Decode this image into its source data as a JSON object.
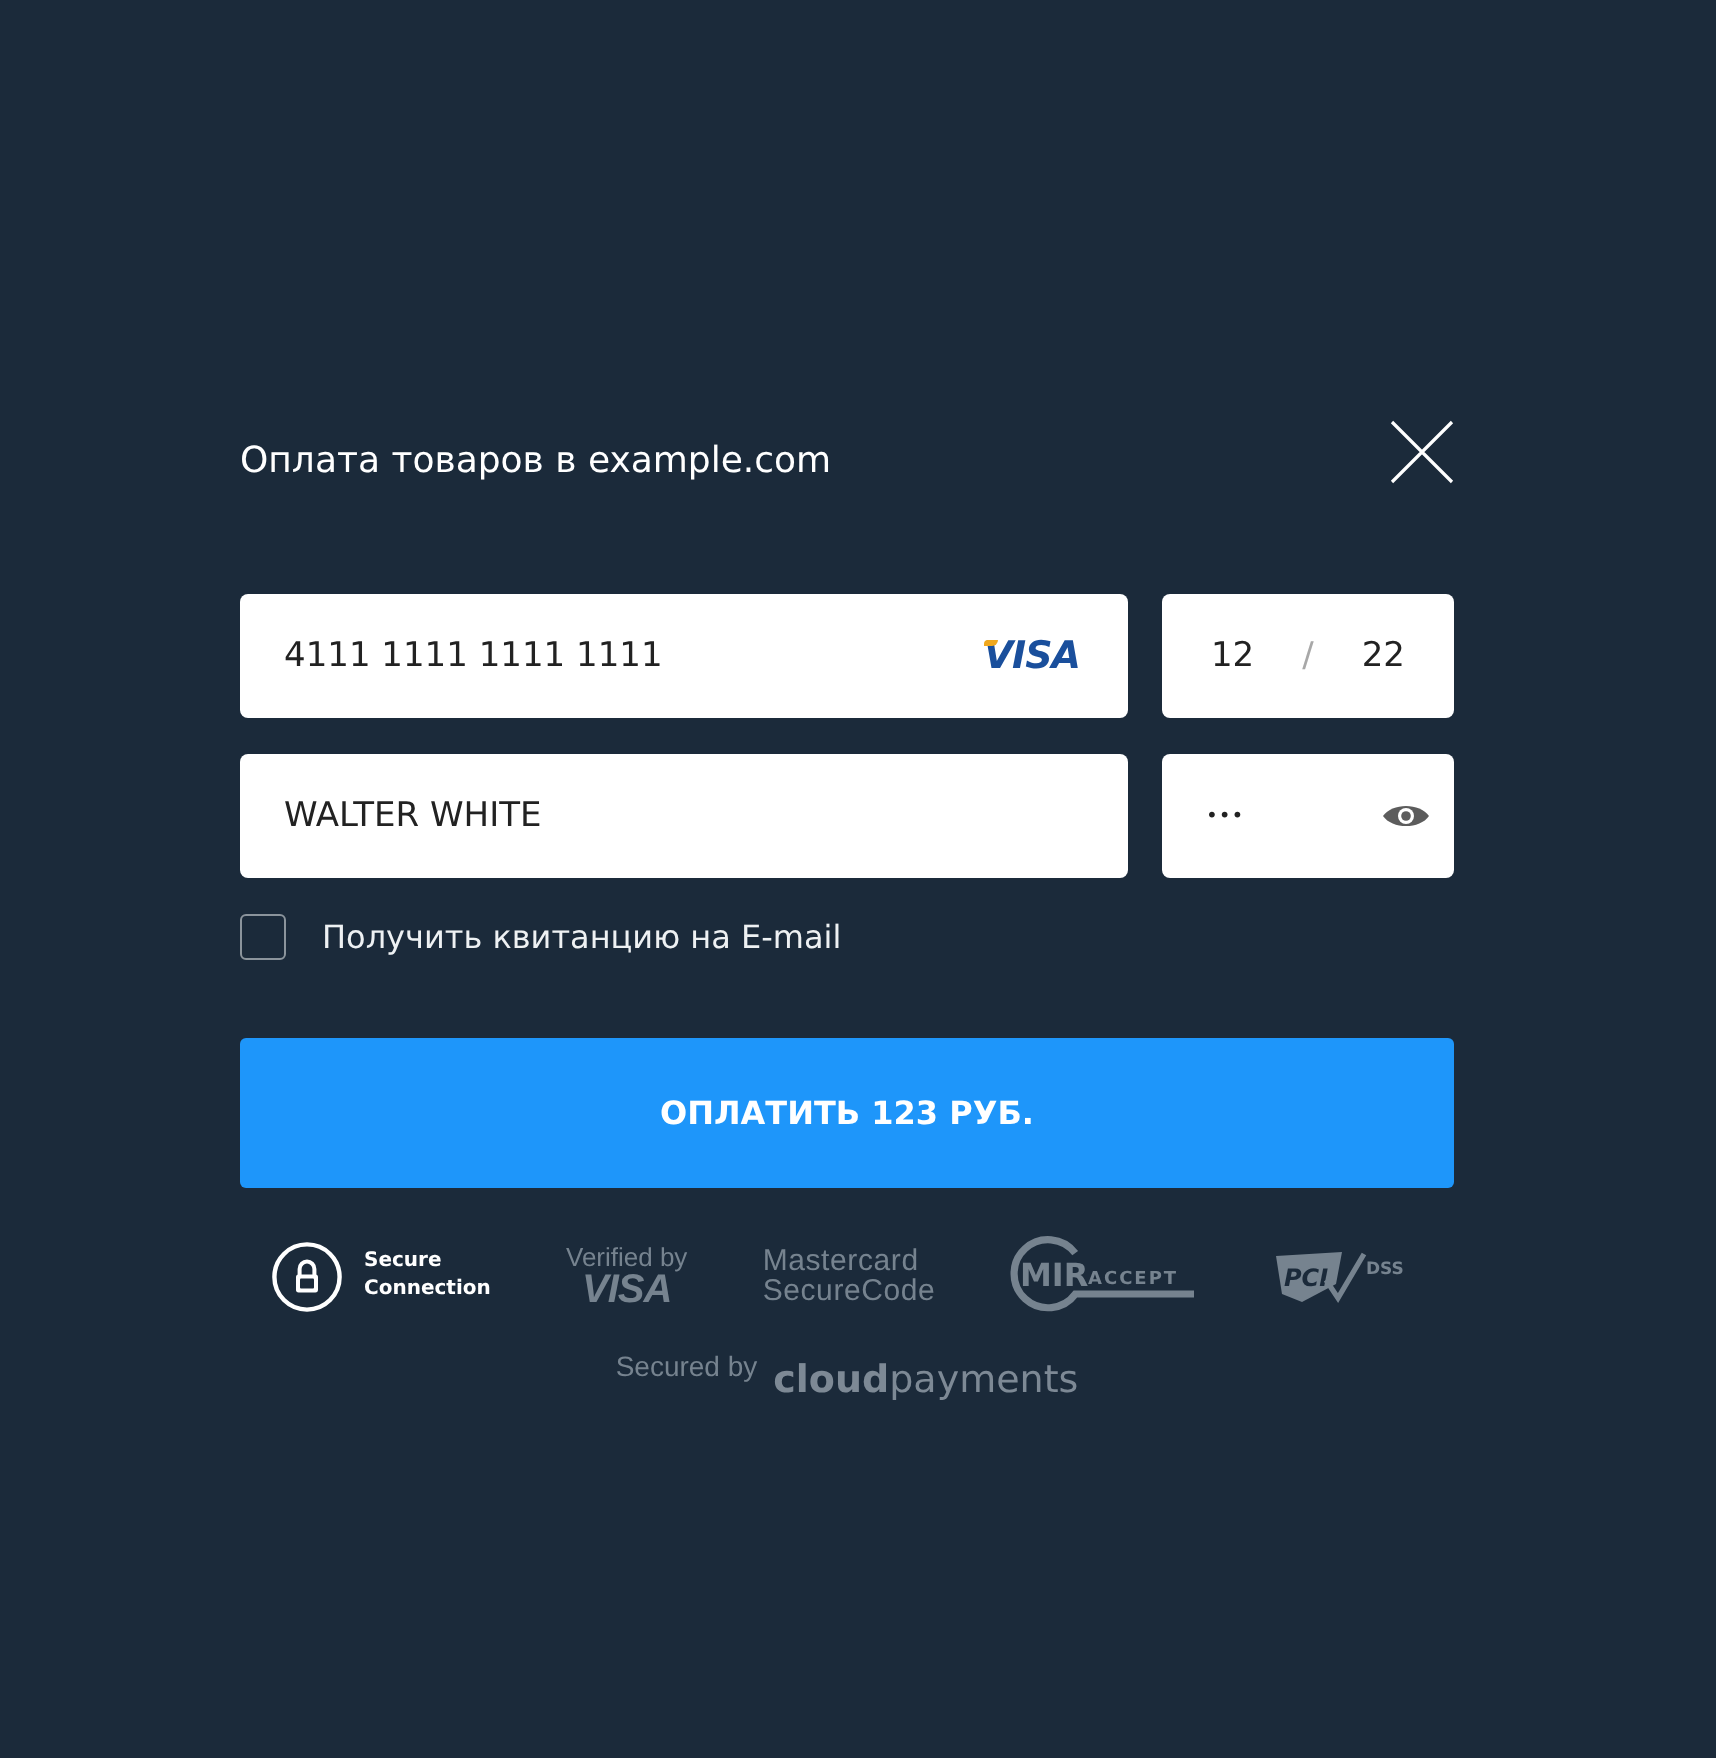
{
  "dialog": {
    "title": "Оплата товаров в example.com"
  },
  "card_number": {
    "value": "4111 1111 1111 1111",
    "brand": "VISA"
  },
  "expiry": {
    "month": "12",
    "separator": "/",
    "year": "22"
  },
  "cardholder": {
    "value": "WALTER WHITE"
  },
  "cvv": {
    "value": "•••"
  },
  "receipt": {
    "label": "Получить квитанцию на E-mail",
    "checked": false
  },
  "pay_button": {
    "label": "ОПЛАТИТЬ 123 РУБ."
  },
  "badges": [
    {
      "kind": "secure",
      "lines": [
        "Secure",
        "Connection"
      ]
    },
    {
      "kind": "verified_visa",
      "lines": [
        "Verified by",
        "VISA"
      ]
    },
    {
      "kind": "mastercard",
      "lines": [
        "Mastercard",
        "SecureCode"
      ]
    },
    {
      "kind": "mir",
      "lines": [
        "MIR",
        "ACCEPT"
      ]
    },
    {
      "kind": "pci",
      "lines": [
        "PCI",
        "DSS"
      ]
    }
  ],
  "footer": {
    "caption": "Secured by",
    "logo": "**cloud**payments"
  }
}
